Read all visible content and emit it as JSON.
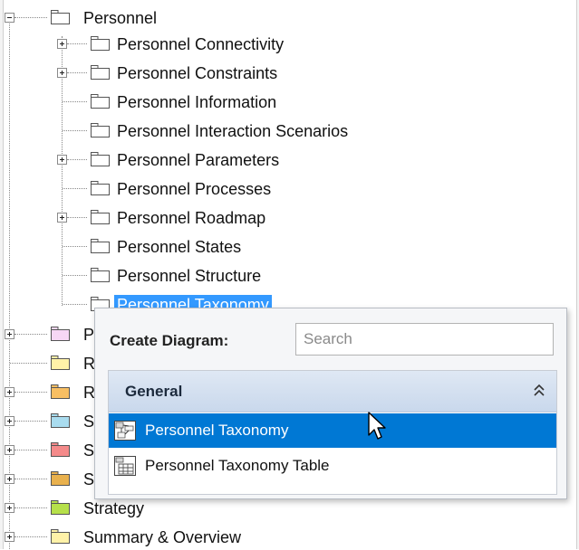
{
  "tree": {
    "root_label": "Personnel",
    "children": [
      {
        "label": "Personnel Connectivity",
        "expandable": true
      },
      {
        "label": "Personnel Constraints",
        "expandable": true
      },
      {
        "label": "Personnel Information",
        "expandable": false
      },
      {
        "label": "Personnel Interaction Scenarios",
        "expandable": false
      },
      {
        "label": "Personnel Parameters",
        "expandable": true
      },
      {
        "label": "Personnel Processes",
        "expandable": false
      },
      {
        "label": "Personnel Roadmap",
        "expandable": true
      },
      {
        "label": "Personnel States",
        "expandable": false
      },
      {
        "label": "Personnel Structure",
        "expandable": false
      },
      {
        "label": "Personnel Taxonomy",
        "expandable": false,
        "selected": true
      }
    ],
    "siblings": [
      {
        "label": "P",
        "color": "#f7d7f5"
      },
      {
        "label": "R",
        "color": "#fff2a8"
      },
      {
        "label": "R",
        "color": "#f8bf63"
      },
      {
        "label": "S",
        "color": "#a9dcef"
      },
      {
        "label": "S",
        "color": "#f48a8a"
      },
      {
        "label": "S",
        "color": "#e9b14d"
      },
      {
        "label": "Strategy",
        "color": "#b6e04a"
      },
      {
        "label": "Summary & Overview",
        "color": "#fff2a8"
      }
    ]
  },
  "popup": {
    "title": "Create Diagram:",
    "search_placeholder": "Search",
    "group_label": "General",
    "items": [
      {
        "label": "Personnel Taxonomy",
        "selected": true
      },
      {
        "label": "Personnel Taxonomy Table",
        "selected": false
      }
    ]
  },
  "colors": {
    "selection": "#3399ff",
    "popup_selection": "#0078d4",
    "group_header": "#d3dfef"
  }
}
